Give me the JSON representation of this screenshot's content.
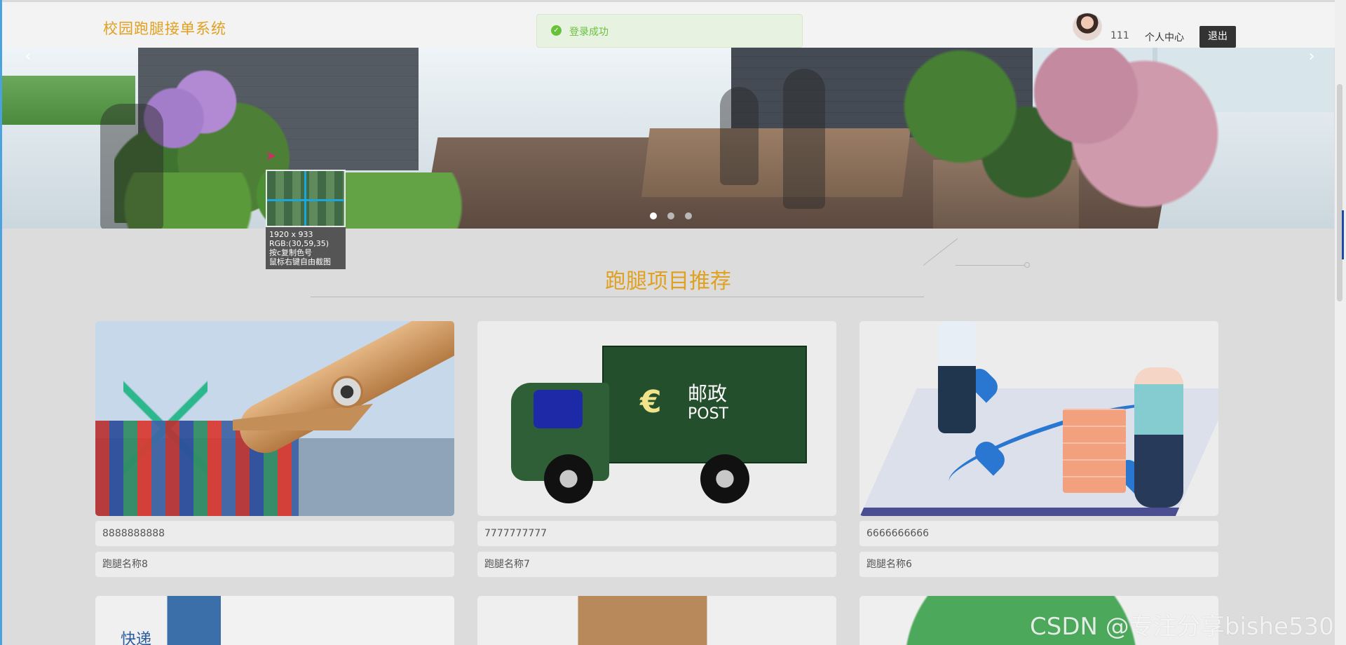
{
  "header": {
    "brand": "校园跑腿接单系统",
    "toast": "登录成功",
    "user_id": "111",
    "personal_center": "个人中心",
    "logout": "退出"
  },
  "banner": {
    "left_arrow": "‹",
    "right_arrow": "›"
  },
  "color_picker": {
    "info": [
      "1920 x 933",
      "RGB:(30,59,35)",
      "按c复制色号",
      "鼠标右键自由截图"
    ]
  },
  "section": {
    "title": "跑腿项目推荐"
  },
  "cards": [
    {
      "number": "8888888888",
      "name": "跑腿名称8"
    },
    {
      "number": "7777777777",
      "name": "跑腿名称7"
    },
    {
      "number": "6666666666",
      "name": "跑腿名称6"
    }
  ],
  "next_row": {
    "label": "快递"
  },
  "watermark": "CSDN @专注分享bishe530",
  "truck": {
    "logo": "€",
    "cn": "邮政",
    "en": "POST"
  },
  "colors": {
    "brand": "#e0a020",
    "toast_text": "#67c23a",
    "logout_bg": "#333333",
    "selection_accent": "#1ca6d9"
  }
}
